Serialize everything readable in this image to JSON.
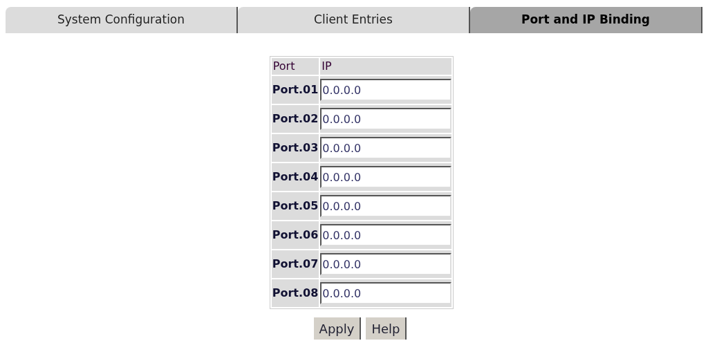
{
  "tabs": [
    {
      "label": "System Configuration",
      "selected": false
    },
    {
      "label": "Client Entries",
      "selected": false
    },
    {
      "label": "Port and IP Binding",
      "selected": true
    }
  ],
  "table": {
    "columns": [
      "Port",
      "IP"
    ],
    "rows": [
      {
        "port": "Port.01",
        "ip": "0.0.0.0"
      },
      {
        "port": "Port.02",
        "ip": "0.0.0.0"
      },
      {
        "port": "Port.03",
        "ip": "0.0.0.0"
      },
      {
        "port": "Port.04",
        "ip": "0.0.0.0"
      },
      {
        "port": "Port.05",
        "ip": "0.0.0.0"
      },
      {
        "port": "Port.06",
        "ip": "0.0.0.0"
      },
      {
        "port": "Port.07",
        "ip": "0.0.0.0"
      },
      {
        "port": "Port.08",
        "ip": "0.0.0.0"
      }
    ]
  },
  "buttons": [
    "Apply",
    "Help"
  ]
}
